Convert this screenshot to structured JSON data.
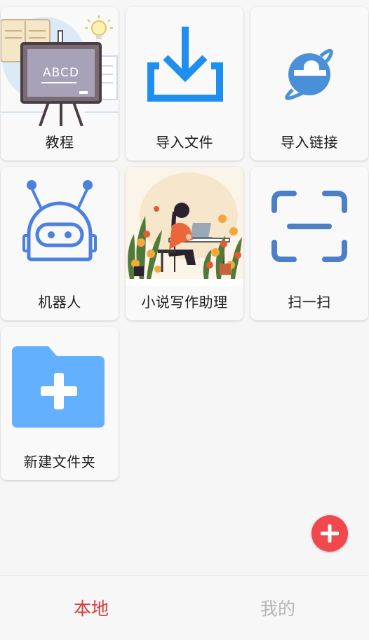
{
  "cards": [
    {
      "label": "教程",
      "icon": "tutorial-blackboard-icon"
    },
    {
      "label": "导入文件",
      "icon": "import-file-download-icon"
    },
    {
      "label": "导入链接",
      "icon": "ie-browser-link-icon"
    },
    {
      "label": "机器人",
      "icon": "robot-icon"
    },
    {
      "label": "小说写作助理",
      "icon": "novel-writing-illustration"
    },
    {
      "label": "扫一扫",
      "icon": "scan-frame-icon"
    },
    {
      "label": "新建文件夹",
      "icon": "new-folder-icon"
    }
  ],
  "blackboard_text": "ABCD",
  "bottom_nav": {
    "tabs": [
      {
        "label": "本地",
        "active": true
      },
      {
        "label": "我的",
        "active": false
      }
    ]
  },
  "colors": {
    "accent_red": "#d93a3a",
    "fab_red": "#f2474c",
    "icon_blue": "#1e8ff0",
    "robot_blue": "#4b7fe0",
    "scan_blue": "#4c7fc6",
    "folder_blue": "#62b0ff"
  }
}
